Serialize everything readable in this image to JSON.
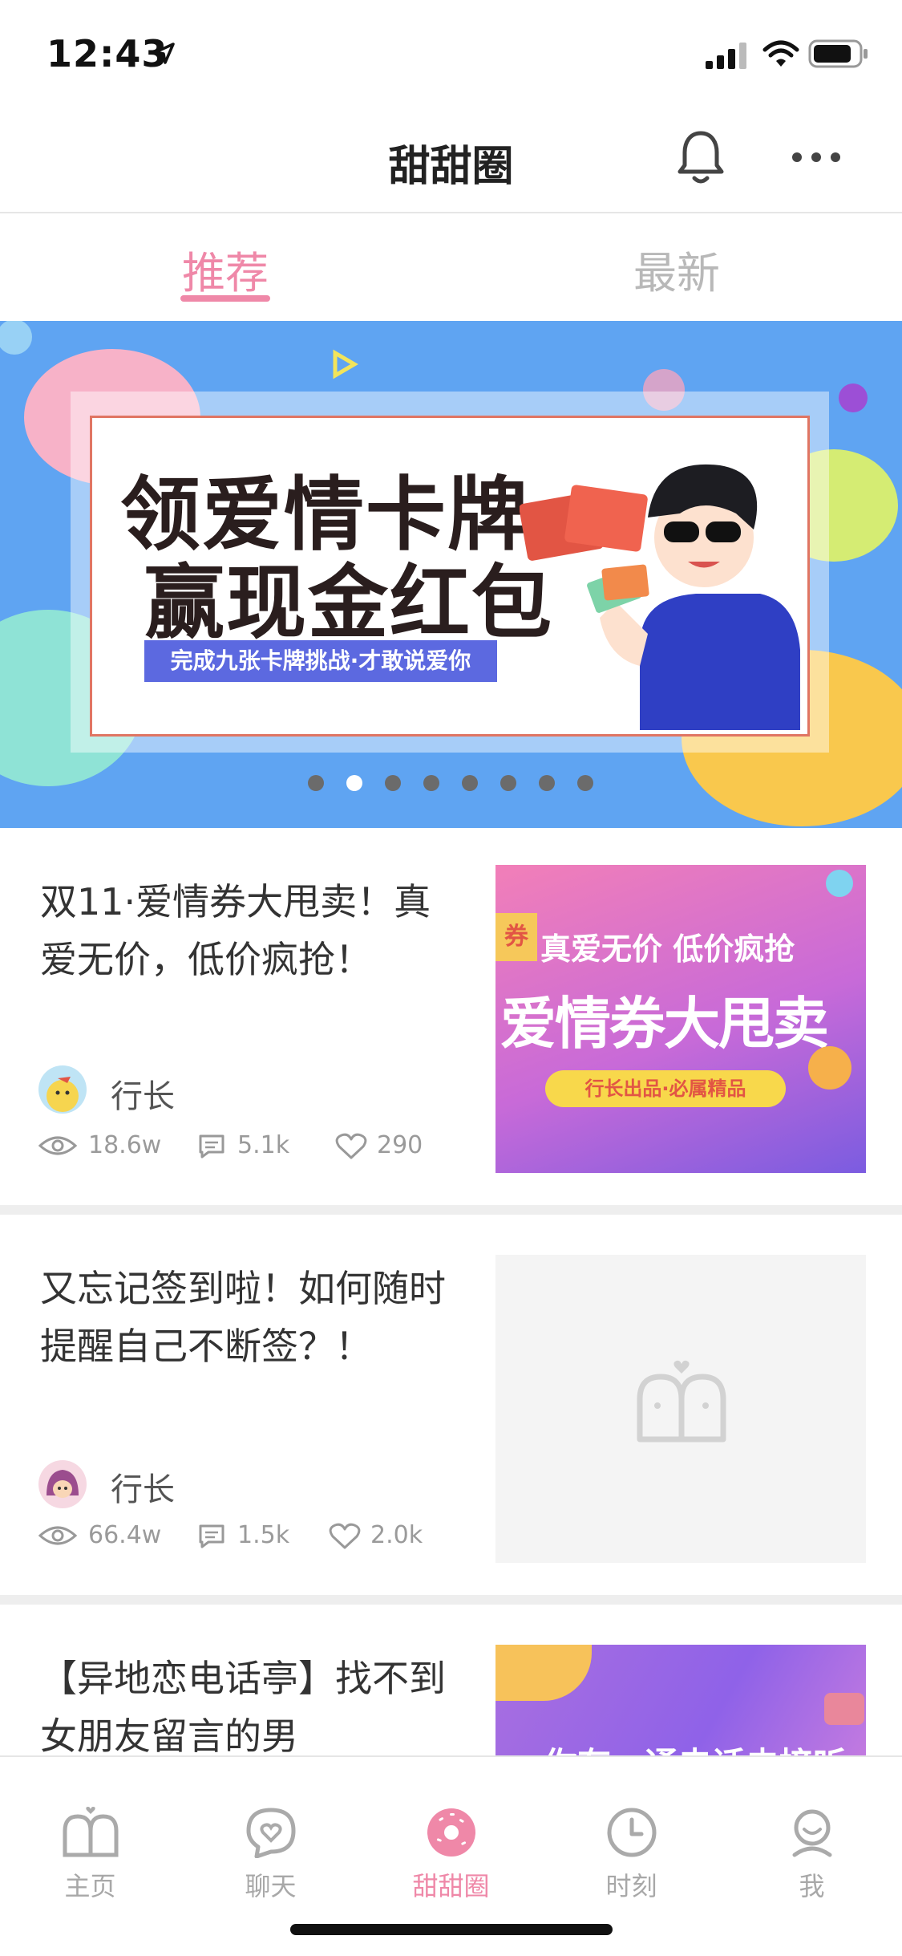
{
  "status_bar": {
    "time": "12:43"
  },
  "nav": {
    "title": "甜甜圈"
  },
  "tabs": [
    {
      "label": "推荐"
    },
    {
      "label": "最新"
    }
  ],
  "banner": {
    "line1": "领爱情卡牌",
    "line2": "赢现金红包",
    "subtitle": "完成九张卡牌挑战·才敢说爱你",
    "pages": 8,
    "active_page": 2
  },
  "posts": [
    {
      "title": "双11·爱情券大甩卖！真爱无价，低价疯抢！",
      "author": "行长",
      "views": "18.6w",
      "comments": "5.1k",
      "likes": "290",
      "thumb_line1": "真爱无价 低价疯抢",
      "thumb_line2": "爱情券大甩卖",
      "thumb_pill": "行长出品·必属精品",
      "thumb_badge": "券"
    },
    {
      "title": "又忘记签到啦！如何随时提醒自己不断签？！",
      "author": "行长",
      "views": "66.4w",
      "comments": "1.5k",
      "likes": "2.0k"
    },
    {
      "title": "【异地恋电话亭】找不到女朋友留言的男",
      "thumb_text": "你有一通电话未接听"
    }
  ],
  "tabbar": [
    {
      "label": "主页"
    },
    {
      "label": "聊天"
    },
    {
      "label": "甜甜圈"
    },
    {
      "label": "时刻"
    },
    {
      "label": "我"
    }
  ],
  "colors": {
    "accent": "#ef88a8",
    "banner_bg": "#5fa4f2",
    "muted": "#a8a8a8"
  }
}
